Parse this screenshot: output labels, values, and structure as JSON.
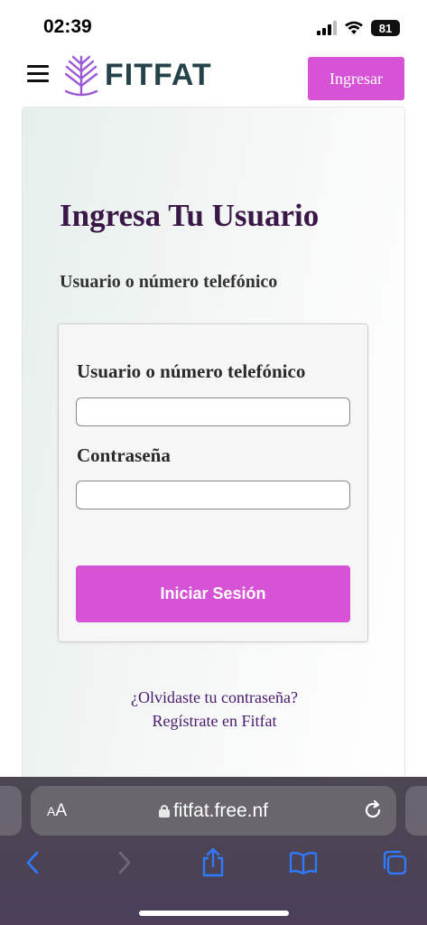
{
  "status": {
    "time": "02:39",
    "battery": "81"
  },
  "nav": {
    "logo_text": "FITFAT",
    "login_button": "Ingresar"
  },
  "main": {
    "title": "Ingresa Tu Usuario",
    "subtitle": "Usuario o número telefónico",
    "form": {
      "user_label": "Usuario o número telefónico",
      "user_value": "",
      "password_label": "Contraseña",
      "password_value": "",
      "submit_label": "Iniciar Sesión"
    },
    "forgot_link": "¿Olvidaste tu contraseña?",
    "register_link": "Regístrate en Fitfat"
  },
  "browser": {
    "text_size_label_small": "A",
    "text_size_label_large": "A",
    "url": "fitfat.free.nf"
  },
  "colors": {
    "accent": "#d653d6",
    "title": "#3a1747",
    "logo": "#24424a",
    "logo_leaf": "#9b59d6",
    "link": "#4a1a6e",
    "safari_icon": "#2f7bff"
  }
}
